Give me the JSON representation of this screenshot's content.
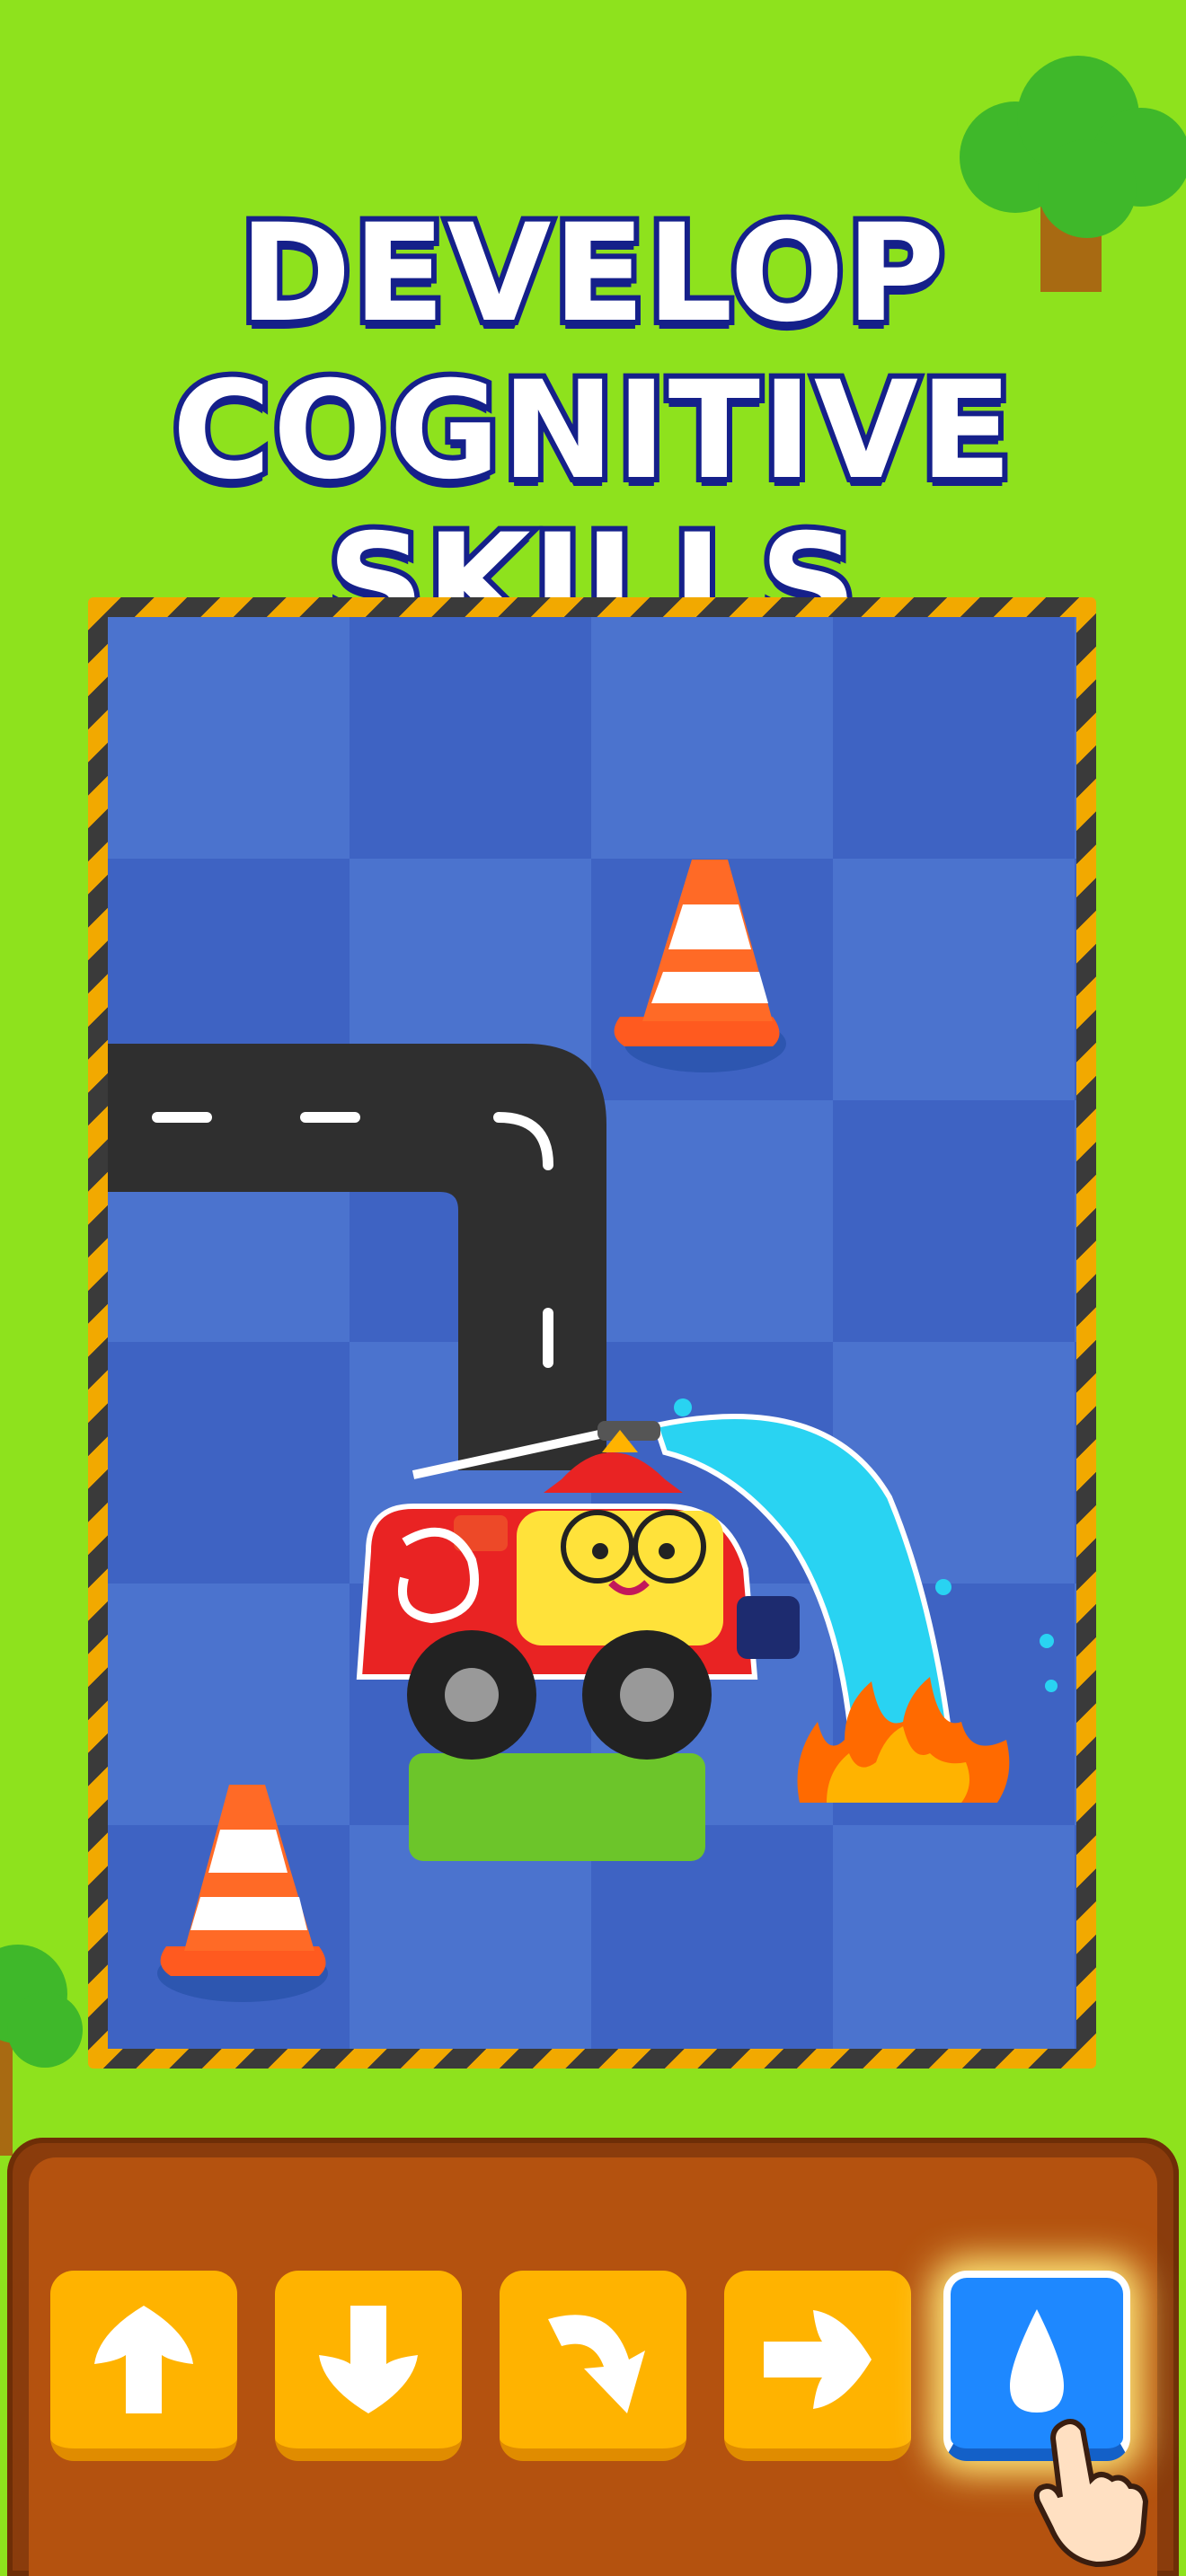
{
  "headline": {
    "line1": "DEVELOP",
    "line2": "COGNITIVE SKILLS"
  },
  "colors": {
    "background": "#8ee21d",
    "board": "#4b73ce",
    "panel": "#b4520f",
    "command": "#ffb300",
    "selected_command": "#1e88ff"
  },
  "commands": [
    {
      "icon": "arrow-up-icon",
      "selected": false
    },
    {
      "icon": "arrow-down-icon",
      "selected": false
    },
    {
      "icon": "turn-arrow-icon",
      "selected": false
    },
    {
      "icon": "arrow-right-icon",
      "selected": false
    },
    {
      "icon": "water-drop-icon",
      "selected": true
    }
  ]
}
